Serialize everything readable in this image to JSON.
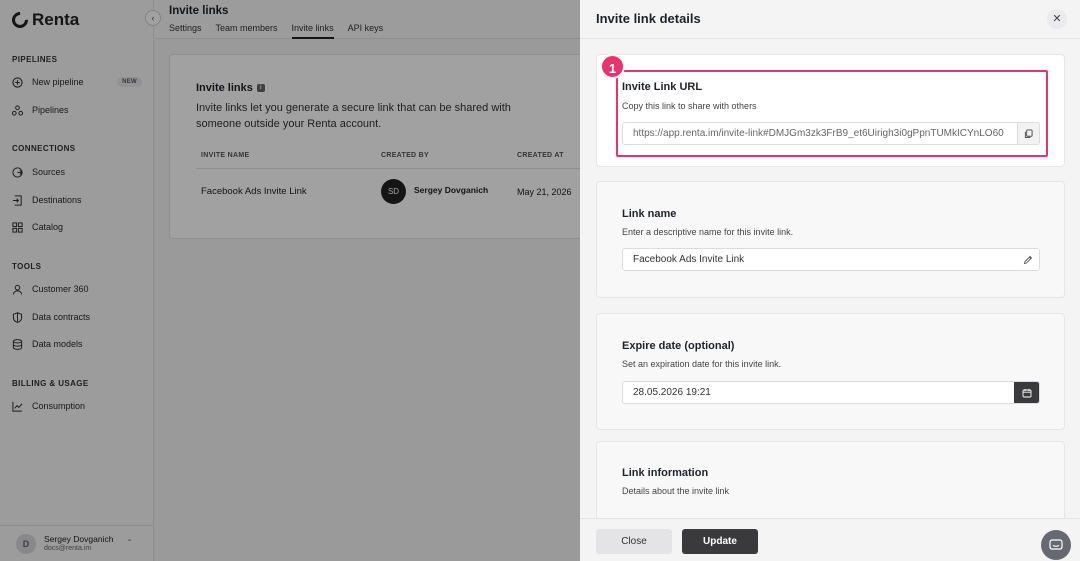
{
  "sidebar": {
    "logo": "Renta",
    "collapse_icon": "collapse-left-icon",
    "sections": [
      {
        "label": "PIPELINES",
        "items": [
          {
            "label": "New pipeline",
            "icon": "plus-circle-icon",
            "badge": "NEW"
          },
          {
            "label": "Pipelines",
            "icon": "pipelines-icon"
          }
        ]
      },
      {
        "label": "CONNECTIONS",
        "items": [
          {
            "label": "Sources",
            "icon": "sources-icon"
          },
          {
            "label": "Destinations",
            "icon": "destinations-icon"
          },
          {
            "label": "Catalog",
            "icon": "catalog-icon"
          }
        ]
      },
      {
        "label": "TOOLS",
        "items": [
          {
            "label": "Customer 360",
            "icon": "user-icon"
          },
          {
            "label": "Data contracts",
            "icon": "shield-icon"
          },
          {
            "label": "Data models",
            "icon": "database-icon"
          }
        ]
      },
      {
        "label": "BILLING & USAGE",
        "items": [
          {
            "label": "Consumption",
            "icon": "chart-icon"
          }
        ]
      }
    ],
    "user": {
      "initial": "D",
      "name": "Sergey Dovganich",
      "email": "docs@renta.im"
    }
  },
  "main": {
    "title": "Invite links",
    "tabs": [
      "Settings",
      "Team members",
      "Invite links",
      "API keys"
    ],
    "active_tab": "Invite links",
    "card": {
      "title": "Invite links",
      "description": "Invite links let you generate a secure link that can be shared with someone outside your Renta account.",
      "columns": [
        "INVITE NAME",
        "CREATED BY",
        "CREATED AT"
      ],
      "rows": [
        {
          "name": "Facebook Ads Invite Link",
          "creator_initials": "SD",
          "creator": "Sergey Dovganich",
          "created_at": "May 21, 2026"
        }
      ]
    }
  },
  "drawer": {
    "title": "Invite link details",
    "step_badge": "1",
    "url_section": {
      "title": "Invite Link URL",
      "description": "Copy this link to share with others",
      "value": "https://app.renta.im/invite-link#DMJGm3zk3FrB9_et6Uirigh3i0gPpnTUMkICYnLO60"
    },
    "name_section": {
      "title": "Link name",
      "description": "Enter a descriptive name for this invite link.",
      "value": "Facebook Ads Invite Link"
    },
    "expire_section": {
      "title": "Expire date (optional)",
      "description": "Set an expiration date for this invite link.",
      "value": "28.05.2026 19:21"
    },
    "info_section": {
      "title": "Link information",
      "description": "Details about the invite link"
    },
    "close_label": "Close",
    "update_label": "Update"
  },
  "colors": {
    "accent": "#e8336e",
    "dark_button": "#3a3a3d"
  }
}
